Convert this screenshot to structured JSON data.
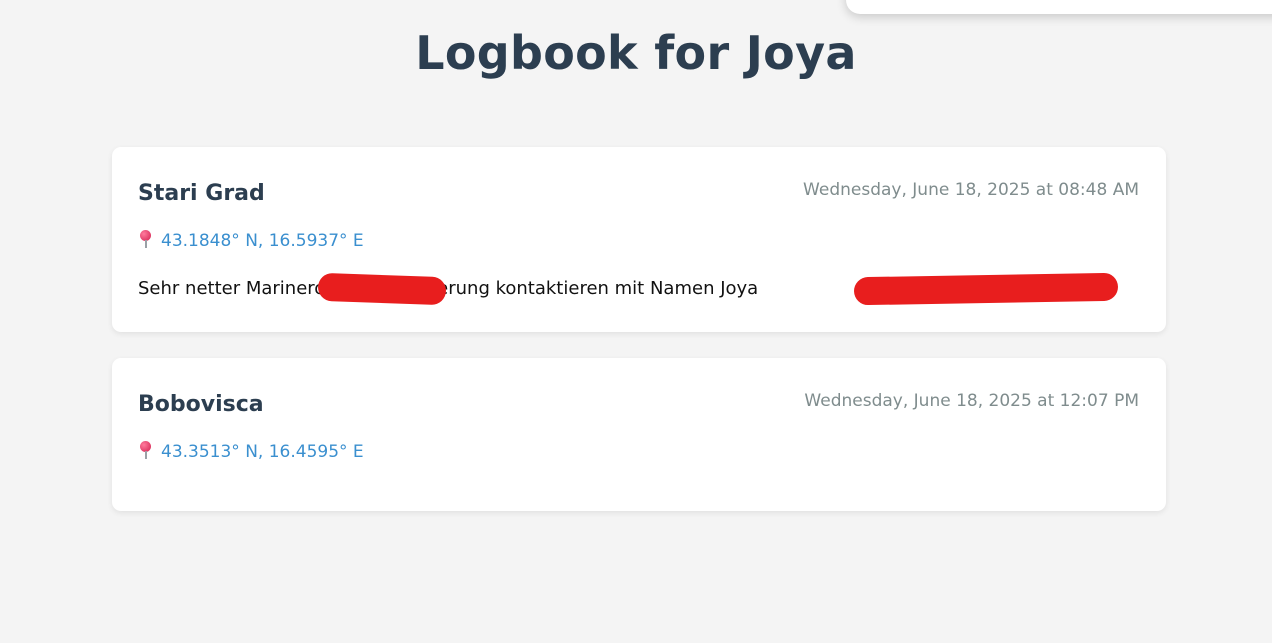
{
  "page": {
    "title": "Logbook for Joya"
  },
  "entries": [
    {
      "name": "Stari Grad",
      "date": "Wednesday, June 18, 2025 at 08:48 AM",
      "coords": "43.1848° N, 16.5937° E",
      "note": "Sehr netter Marinero,                    Bei Reservierung kontaktieren mit Namen Joya"
    },
    {
      "name": "Bobovisca",
      "date": "Wednesday, June 18, 2025 at 12:07 PM",
      "coords": "43.3513° N, 16.4595° E"
    }
  ],
  "icons": {
    "location": "pushpin-icon"
  },
  "colors": {
    "background": "#f4f4f4",
    "title": "#2c3e50",
    "link": "#3a8fcf",
    "date": "#7f8c8d",
    "redaction": "#e81e1e"
  }
}
